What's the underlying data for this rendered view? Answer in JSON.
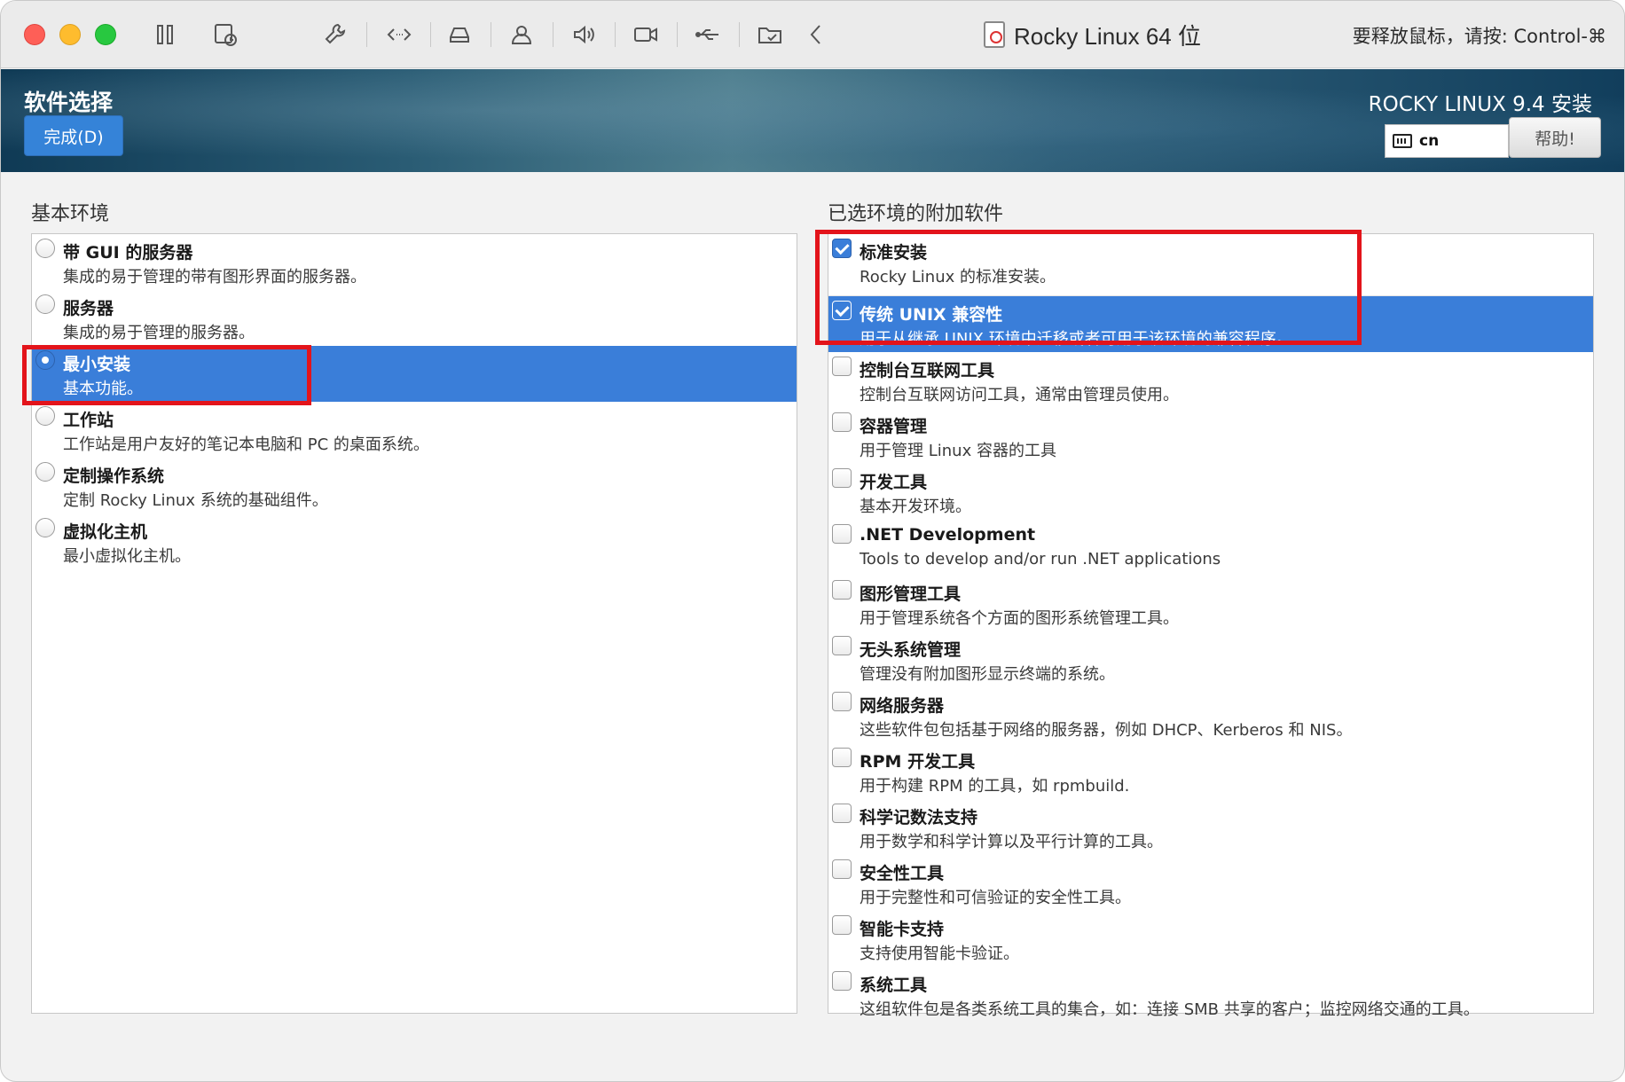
{
  "titlebar": {
    "vm_name": "Rocky Linux 64 位",
    "release_hint": "要释放鼠标，请按: Control-⌘",
    "icons": [
      "pause-icon",
      "snapshot-icon",
      "settings-wrench-icon",
      "code-arrows-icon",
      "disk-drive-icon",
      "user-account-icon",
      "volume-icon",
      "camera-icon",
      "usb-icon",
      "shared-folder-icon",
      "chevron-left-icon"
    ]
  },
  "header": {
    "spoke_title": "软件选择",
    "done_label": "完成(D)",
    "product": "ROCKY LINUX 9.4 安装",
    "keyboard_layout": "cn",
    "help_label": "帮助!"
  },
  "left": {
    "label": "基本环境",
    "items": [
      {
        "name": "带 GUI 的服务器",
        "desc": "集成的易于管理的带有图形界面的服务器。",
        "selected": false
      },
      {
        "name": "服务器",
        "desc": "集成的易于管理的服务器。",
        "selected": false
      },
      {
        "name": "最小安装",
        "desc": "基本功能。",
        "selected": true
      },
      {
        "name": "工作站",
        "desc": "工作站是用户友好的笔记本电脑和 PC 的桌面系统。",
        "selected": false
      },
      {
        "name": "定制操作系统",
        "desc": "定制 Rocky Linux 系统的基础组件。",
        "selected": false
      },
      {
        "name": "虚拟化主机",
        "desc": "最小虚拟化主机。",
        "selected": false
      }
    ]
  },
  "right": {
    "label": "已选环境的附加软件",
    "items": [
      {
        "name": "标准安装",
        "desc": "Rocky Linux 的标准安装。",
        "checked": true,
        "selected": false
      },
      {
        "name": "传统 UNIX 兼容性",
        "desc": "用于从继承 UNIX 环境中迁移或者可用于该环境的兼容程序。",
        "checked": true,
        "selected": true
      },
      {
        "name": "控制台互联网工具",
        "desc": "控制台互联网访问工具，通常由管理员使用。",
        "checked": false,
        "selected": false
      },
      {
        "name": "容器管理",
        "desc": "用于管理 Linux 容器的工具",
        "checked": false,
        "selected": false
      },
      {
        "name": "开发工具",
        "desc": "基本开发环境。",
        "checked": false,
        "selected": false
      },
      {
        "name": ".NET Development",
        "desc": "Tools to develop and/or run .NET applications",
        "checked": false,
        "selected": false
      },
      {
        "name": "图形管理工具",
        "desc": "用于管理系统各个方面的图形系统管理工具。",
        "checked": false,
        "selected": false
      },
      {
        "name": "无头系统管理",
        "desc": "管理没有附加图形显示终端的系统。",
        "checked": false,
        "selected": false
      },
      {
        "name": "网络服务器",
        "desc": "这些软件包包括基于网络的服务器，例如 DHCP、Kerberos 和 NIS。",
        "checked": false,
        "selected": false
      },
      {
        "name": "RPM 开发工具",
        "desc": "用于构建 RPM 的工具，如 rpmbuild.",
        "checked": false,
        "selected": false
      },
      {
        "name": "科学记数法支持",
        "desc": "用于数学和科学计算以及平行计算的工具。",
        "checked": false,
        "selected": false
      },
      {
        "name": "安全性工具",
        "desc": "用于完整性和可信验证的安全性工具。",
        "checked": false,
        "selected": false
      },
      {
        "name": "智能卡支持",
        "desc": "支持使用智能卡验证。",
        "checked": false,
        "selected": false
      },
      {
        "name": "系统工具",
        "desc": "这组软件包是各类系统工具的集合，如：连接 SMB 共享的客户；监控网络交通的工具。",
        "checked": false,
        "selected": false
      }
    ]
  },
  "colors": {
    "selection": "#3a7ed9",
    "annotation": "#e3141b",
    "done_button": "#3583d8"
  }
}
